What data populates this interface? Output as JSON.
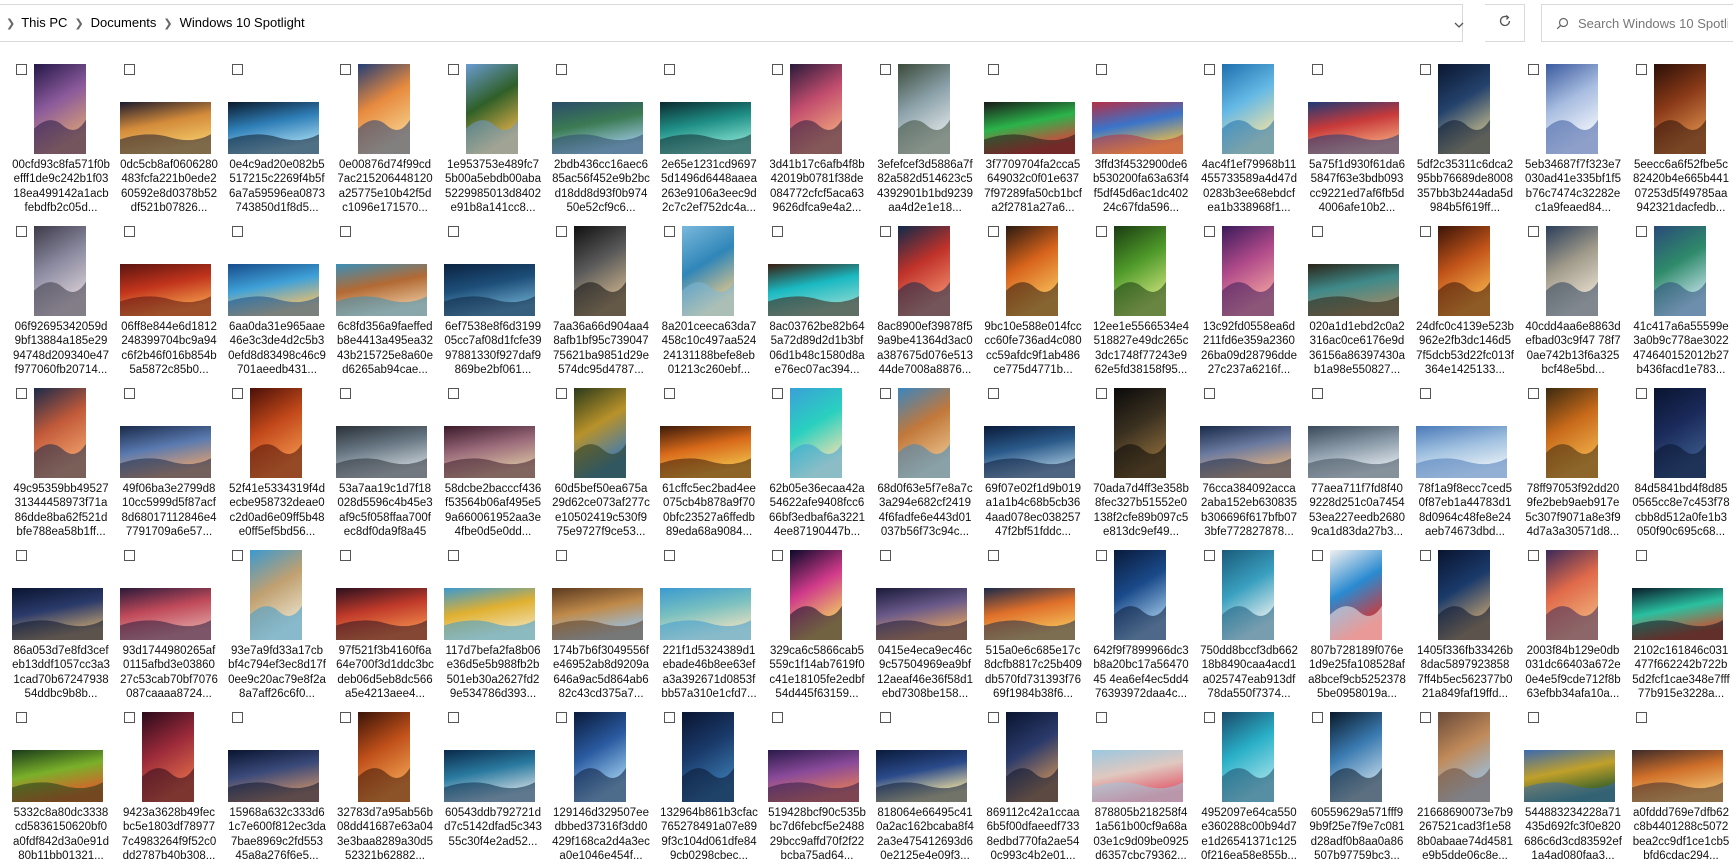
{
  "address_bar": {
    "breadcrumbs": [
      "This PC",
      "Documents",
      "Windows 10 Spotlight"
    ]
  },
  "search": {
    "placeholder": "Search Windows 10 Spotlight"
  },
  "icons": {
    "refresh": "refresh-icon",
    "search": "search-icon",
    "dropdown": "chevron-down-icon",
    "separator": "chevron-right-icon"
  },
  "files": [
    {
      "name": "00cfd93c8fa571f0befff1de9c242b1f0318ea499142a1acbfebdfb2c05d...",
      "orientation": "portrait",
      "colors": [
        "#241848",
        "#8b5a9b",
        "#d8a077"
      ]
    },
    {
      "name": "0dc5cb8af0606280483fcfa221b0ede260592e8d0378b52df521b07826...",
      "orientation": "landscape",
      "colors": [
        "#1d1b2e",
        "#d38b3a",
        "#f4c96a"
      ]
    },
    {
      "name": "0e4c9ad20e082b5517215c2269f4b5f6a7a59596ea0873743850d1f8d5...",
      "orientation": "landscape",
      "colors": [
        "#0b1a2b",
        "#2f7fb8",
        "#a3d8ef"
      ]
    },
    {
      "name": "0e00876d74f99cd7ac215206448120a25775e10b42f5dc1096e171570...",
      "orientation": "portrait",
      "colors": [
        "#223e75",
        "#e78a3e",
        "#f6d08c"
      ]
    },
    {
      "name": "1e953753e489fc75b00a5ebdb00aba5229985013d8402e91b8a141cc8...",
      "orientation": "portrait",
      "colors": [
        "#6b9bd1",
        "#2f5f28",
        "#e2b04a"
      ]
    },
    {
      "name": "2bdb436cc16aec685ac56f452e9b2bcd18dd8d93f0b97450e52cf9c6...",
      "orientation": "landscape",
      "colors": [
        "#2b4b6b",
        "#3b7b53",
        "#9ac4de"
      ]
    },
    {
      "name": "2e65e1231cd96975d1496d6448aaea263e9106a3eec9d2c7c2ef752dc4a...",
      "orientation": "landscape",
      "colors": [
        "#0c2a30",
        "#1f8f86",
        "#85e0d0"
      ]
    },
    {
      "name": "3d41b17c6afb4f8b42019b0781f38de084772cfcf5aca639626dfca9e4a2...",
      "orientation": "portrait",
      "colors": [
        "#2a1a3a",
        "#c24d6e",
        "#f1a57d"
      ]
    },
    {
      "name": "3efefcef3d5886a7f82a582d514623c54392901b1bd9239aa4d2e1e18...",
      "orientation": "portrait",
      "colors": [
        "#3b4a3a",
        "#8aa0a8",
        "#dfe6e8"
      ]
    },
    {
      "name": "3f7709704fa2cca5649032c0f01e6377f97289fa50cb1bcfa2f2781a27a6...",
      "orientation": "landscape",
      "colors": [
        "#1a1a1a",
        "#2bb34a",
        "#e23c3c"
      ]
    },
    {
      "name": "3ffd3f4532900de6b530200fa63a63f4f5df45d6ac1dc40224c67fda596...",
      "orientation": "landscape",
      "colors": [
        "#b52f45",
        "#3a74c9",
        "#f0c043"
      ]
    },
    {
      "name": "4ac4f1ef79968b11455733589a4d47d0283b3ee68ebdcfea1b338968f1...",
      "orientation": "portrait",
      "colors": [
        "#1e6fae",
        "#65b9e5",
        "#f0e1a5"
      ]
    },
    {
      "name": "5a75f1d930f61da65847f63e3bdb093cc9221ed7af6fb5d4006afe10b2...",
      "orientation": "landscape",
      "colors": [
        "#1d3a76",
        "#c83a3a",
        "#f2a27a"
      ]
    },
    {
      "name": "5df2c35311c6dca295bb76689de8008357bb3b244ada5d984b5f619ff...",
      "orientation": "portrait",
      "colors": [
        "#0a1630",
        "#24426c",
        "#c2b98a"
      ]
    },
    {
      "name": "5eb34687f7f323e7030ad41e335bf1f5b76c7474c32282ec1a9feaed84...",
      "orientation": "portrait",
      "colors": [
        "#3b5aa0",
        "#a8bde0",
        "#f3f6fb"
      ]
    },
    {
      "name": "5eecc6a6f52fbe5c82420b4e665b44107253d5f49785aa942321dacfedb...",
      "orientation": "portrait",
      "colors": [
        "#2a0f08",
        "#8a3a18",
        "#d88a4a"
      ]
    },
    {
      "name": "06f92695342059d9bf13884a185e2994748d209340e47f977060fb20714...",
      "orientation": "portrait",
      "colors": [
        "#3d3a48",
        "#8b8aa0",
        "#d9cfd6"
      ]
    },
    {
      "name": "06ff8e844e6d1812248399704bc9a94c6f2b46f016b854b5a5872c85b0...",
      "orientation": "landscape",
      "colors": [
        "#5a1410",
        "#c2341c",
        "#f09a4a"
      ]
    },
    {
      "name": "6aa0da31e965aae46e3c3de4d2c5b30efd8d83498c46c9701aeedb431...",
      "orientation": "landscape",
      "colors": [
        "#174c8a",
        "#3fa1d8",
        "#f2c06a"
      ]
    },
    {
      "name": "6c8fd356a9faeffedb8e4413a495ea3243b215725e8a60ed6265ab94cae...",
      "orientation": "landscape",
      "colors": [
        "#3a8fb8",
        "#b26a34",
        "#e8c49a"
      ]
    },
    {
      "name": "6ef7538e8f6d319905cc7af08d1fcfe3997881330f927daf9869be2bf061...",
      "orientation": "landscape",
      "colors": [
        "#0b2240",
        "#1d4f7a",
        "#6aa6c8"
      ]
    },
    {
      "name": "7aa36a66d904aa48afb1bf95c73904775621ba9851d29e574dc95d4787...",
      "orientation": "portrait",
      "colors": [
        "#101010",
        "#5a5a5a",
        "#c9b08a"
      ]
    },
    {
      "name": "8a201ceeca63da7458c10c497aa52424131188befe8eb01213c260ebf...",
      "orientation": "portrait",
      "colors": [
        "#7ab8dc",
        "#2f86b8",
        "#e6c88a"
      ]
    },
    {
      "name": "8ac03762be82b645a72d89d2d1b3bf06d1b48c1580d8ae76ec07ac394...",
      "orientation": "landscape",
      "colors": [
        "#3a1c0e",
        "#1ab9c2",
        "#8ad8d0"
      ]
    },
    {
      "name": "8ac8900ef39878f59a9be41364d3ac0a387675d076e51344de7008a8876...",
      "orientation": "portrait",
      "colors": [
        "#0f2a4a",
        "#c0322a",
        "#f08a6a"
      ]
    },
    {
      "name": "9bc10e588e014fcccc60fe736ad4c080cc59afdc9f1ab486ce775d4771b...",
      "orientation": "portrait",
      "colors": [
        "#2a1a10",
        "#d8641c",
        "#f6c05a"
      ]
    },
    {
      "name": "12ee1e5566534e4518827e49dc265c3dc1748f77243e962e5fd38158f95...",
      "orientation": "portrait",
      "colors": [
        "#1a3b12",
        "#4f9a2a",
        "#c8e07a"
      ]
    },
    {
      "name": "13c92fd0558ea6d211fd6e359a236026ba09d28796dde27c237a6216f...",
      "orientation": "portrait",
      "colors": [
        "#3a1a5a",
        "#b04a8a",
        "#f0a0a0"
      ]
    },
    {
      "name": "020a1d1ebd2c0a2316ac0ce6176e9d36156a86397430ab1a98e550827...",
      "orientation": "landscape",
      "colors": [
        "#2a2418",
        "#3f8a8a",
        "#9a8a6a"
      ]
    },
    {
      "name": "24dfc0c4139e523b962e2fb3dc146d57f5dcb53d22fc013f364e1425133...",
      "orientation": "portrait",
      "colors": [
        "#3a1408",
        "#c2541a",
        "#f4b04a"
      ]
    },
    {
      "name": "40cdd4aa6e8863defbad03c9f47 78f70ae742b13f6a325bcf48e5bd...",
      "orientation": "portrait",
      "colors": [
        "#2a3e5a",
        "#a09a8a",
        "#e8e0d0"
      ]
    },
    {
      "name": "41c417a6a55599e3a0b9c778ae3022474640152012b27b436facd1e783...",
      "orientation": "portrait",
      "colors": [
        "#2a4a7a",
        "#2f8a6a",
        "#bfe0e8"
      ]
    },
    {
      "name": "49c95359bb4952731344458973f71a86dde8ba62f521dbfe788ea58b1ff...",
      "orientation": "portrait",
      "colors": [
        "#1a2a4a",
        "#c25a3a",
        "#f0a06a"
      ]
    },
    {
      "name": "49f06ba3e2799d810cc5999d5f87acf8d68017112846e47791709a6e57...",
      "orientation": "landscape",
      "colors": [
        "#1a2a4a",
        "#5a7ab0",
        "#e0a070"
      ]
    },
    {
      "name": "52f41e5334319f4decbe958732deae0c2d0ad6e09ff5b48e0ff5ef5bd56...",
      "orientation": "portrait",
      "colors": [
        "#4a1008",
        "#c2481a",
        "#f0904a"
      ]
    },
    {
      "name": "53a7aa19c1d7f18028d5596c4b45e3af9c5f058ffaa700fec8df0da9f8a453...",
      "orientation": "landscape",
      "colors": [
        "#2a3038",
        "#6a7a86",
        "#c8d0d6"
      ]
    },
    {
      "name": "58dcbe2bacccf436f53564b06af495e59a660061952aa3e4fbe0d5e0dd...",
      "orientation": "landscape",
      "colors": [
        "#3a1a2a",
        "#9a6a7a",
        "#d8c0a0"
      ]
    },
    {
      "name": "60d5bef50ea675a29d62ce073af277ce10502419c530f975e9727f9ce53...",
      "orientation": "portrait",
      "colors": [
        "#2a3a1a",
        "#b8922a",
        "#3a7ab8"
      ]
    },
    {
      "name": "61cffc5ec2bad4ee075cb4b878a9f700bfc23527a6ffedb89eda68a9084...",
      "orientation": "landscape",
      "colors": [
        "#3a1a0a",
        "#d86a1a",
        "#f0c04a"
      ]
    },
    {
      "name": "62b05e36ecaa42a54622afe9408fcc666bf3edbaf6a32214ee87190447b...",
      "orientation": "portrait",
      "colors": [
        "#3aa0d8",
        "#2ad0c0",
        "#f0e0b0"
      ]
    },
    {
      "name": "68d0f63e5f7e8a7c3a294e682cf24194f6fadfe6e443d01037b56f73c94c...",
      "orientation": "portrait",
      "colors": [
        "#3a86c0",
        "#c2783a",
        "#e8c08a"
      ]
    },
    {
      "name": "69f07e02f1d9b019a1a1b4c68b5cb364aad078ec03825747f2bf51fddc...",
      "orientation": "landscape",
      "colors": [
        "#0a1a3a",
        "#2a5a8a",
        "#a0c0d8"
      ]
    },
    {
      "name": "70ada7d4ff3e358b8fec327b51552e0138f2cfe89b097c5e813dc9ef49...",
      "orientation": "portrait",
      "colors": [
        "#0a0a0a",
        "#3a3020",
        "#8a6a3a"
      ]
    },
    {
      "name": "76cca384092acca2aba152eb630835b306696f617bfb073bfe772827878...",
      "orientation": "landscape",
      "colors": [
        "#1a2a4a",
        "#6a7aa0",
        "#e0b080"
      ]
    },
    {
      "name": "77aea711f7fd8f409228d251c0a745453ea227eedb26809ca1d83da27b3...",
      "orientation": "landscape",
      "colors": [
        "#3a4a5a",
        "#8a9aa8",
        "#e0e6ec"
      ]
    },
    {
      "name": "78f1a9f8ecc7ced50f87eb1a44783d18d0964c48fe8e24aeb74673dbd...",
      "orientation": "landscape",
      "colors": [
        "#4a7ab8",
        "#a0c0e0",
        "#e8f0f6"
      ]
    },
    {
      "name": "78ff97053f92dd209fe2beb9aeb917e5c307f9071a8e3f94d7a3a30571d8...",
      "orientation": "portrait",
      "colors": [
        "#3a2a10",
        "#c86a1a",
        "#f0b04a"
      ]
    },
    {
      "name": "84d5841bd4f8d850565cc8e7c453f78cbb8d512a0fe1b3050f90c695c68...",
      "orientation": "portrait",
      "colors": [
        "#0a1430",
        "#1a2a5a",
        "#3a5a8a"
      ]
    },
    {
      "name": "86a053d7e8fd3cefeb13ddf1057cc3a31cad70b6724793854ddbc9b8b...",
      "orientation": "landscape",
      "colors": [
        "#0a1430",
        "#2a3a6a",
        "#c0a070"
      ]
    },
    {
      "name": "93d1744980265af0115afbd3e0386027c53cab70bf7076087caaaa8724...",
      "orientation": "landscape",
      "colors": [
        "#2a1a3a",
        "#c04a5a",
        "#e0a0a0"
      ]
    },
    {
      "name": "93e7a9fd33a17cbbf4c794ef3ec8d17f0ee9c20ac79e8f2a8a7aff26c6f0...",
      "orientation": "portrait",
      "colors": [
        "#3a9ad0",
        "#c0a070",
        "#e8e0c8"
      ]
    },
    {
      "name": "97f521f3b4160f6a64e700f3d1ddc3bcdeb06d5eb8dc566a5e4213aee4...",
      "orientation": "landscape",
      "colors": [
        "#2a1020",
        "#c03a2a",
        "#f08a4a"
      ]
    },
    {
      "name": "117d7befa2fa8b06e36d5e5b988fb2b501eb30a2627fd29e534786d393...",
      "orientation": "landscape",
      "colors": [
        "#3a9ad0",
        "#e0b030",
        "#f0e0b0"
      ]
    },
    {
      "name": "174b7b6f3049556fe46952ab8d9209a646a9ac5d864ab682c43cd375a7...",
      "orientation": "landscape",
      "colors": [
        "#5a3a20",
        "#c08a4a",
        "#9ac0e0"
      ]
    },
    {
      "name": "221f1d5324389d1ebade46b8ee63efa3a392671d0853fbb57a310e1cfd7...",
      "orientation": "landscape",
      "colors": [
        "#3a9ad0",
        "#7ac0c0",
        "#e8e0c0"
      ]
    },
    {
      "name": "329ca6c5866cab5559c1f14ab7619f0c41e18105fe2edbf54d445f63159...",
      "orientation": "portrait",
      "colors": [
        "#0a0a2a",
        "#d03a8a",
        "#f0d060"
      ]
    },
    {
      "name": "0415e4eca9ec46c9c57504969ea9bf12aeaf46e36f58d1ebd7308be158...",
      "orientation": "landscape",
      "colors": [
        "#1a1a3a",
        "#6a5a8a",
        "#e0a060"
      ]
    },
    {
      "name": "515a0e6c685e17c8dcfb8817c25b409db570fd731393f7669f1984b38f6...",
      "orientation": "landscape",
      "colors": [
        "#1a2a4a",
        "#e0702a",
        "#f4c05a"
      ]
    },
    {
      "name": "642f9f7899966dc3b8a20bc17a5647045 4ea6ef4ec5dd476393972daa4c...",
      "orientation": "portrait",
      "colors": [
        "#0a1a3a",
        "#1a4a8a",
        "#a0c8e8"
      ]
    },
    {
      "name": "750dd8bccf3db66218b8490caa4acd1a025747eab913df78da550f7374...",
      "orientation": "portrait",
      "colors": [
        "#1a5a7a",
        "#3aa0c0",
        "#e8f0f0"
      ]
    },
    {
      "name": "807b728189f076e1d9e25fa108528afa8bcef9cb52523785be0958019a...",
      "orientation": "portrait",
      "colors": [
        "#f0f0f0",
        "#2a8ad0",
        "#e0302a"
      ]
    },
    {
      "name": "1405f336fb33426b8dac5897923858 7ff4b5ec562377b021a849faf19ffd...",
      "orientation": "portrait",
      "colors": [
        "#0a1430",
        "#1a3a6a",
        "#c0a070"
      ]
    },
    {
      "name": "2003f84b129e0db031dc66403a672e0e4e5f9cde712f8b63efbb34afa10a...",
      "orientation": "portrait",
      "colors": [
        "#3a2a5a",
        "#e06a4a",
        "#f0b07a"
      ]
    },
    {
      "name": "2102c161846c031477f662242b722b5d2fcf1cae348e7fff77b915e3228a...",
      "orientation": "landscape",
      "colors": [
        "#0a1a2a",
        "#2ac0a0",
        "#d04a2a"
      ]
    },
    {
      "name": "5332c8a80dc3338cd5836150620bf0a0fdf842d3a0e91d80b11bb01321...",
      "orientation": "landscape",
      "colors": [
        "#1a3a1a",
        "#7ab02a",
        "#e05a2a"
      ]
    },
    {
      "name": "9423a3628b49fecbc5e1803df789777c4983264f9f52c0dd2787b40b308...",
      "orientation": "portrait",
      "colors": [
        "#2a0a1a",
        "#9a2a3a",
        "#e06a4a"
      ]
    },
    {
      "name": "15968a632c333d61c7e600f812ec3da7bae8969c2fd55345a8a276f6e5...",
      "orientation": "landscape",
      "colors": [
        "#0a1430",
        "#3a4a7a",
        "#c08a6a"
      ]
    },
    {
      "name": "32783d7a95ab56b08dd41687e63a043e3baa8289a30d552321b62882...",
      "orientation": "portrait",
      "colors": [
        "#3a1408",
        "#c0501a",
        "#f0a050"
      ]
    },
    {
      "name": "60543ddb792721dd7c5142dfad5c34355c30f4e2ad52...",
      "orientation": "landscape",
      "colors": [
        "#0a2a4a",
        "#2a7aa0",
        "#c8d8e0"
      ]
    },
    {
      "name": "129146d329507eedbbed37316f3dd0429f168ca2d4a3eca0e1046e454f...",
      "orientation": "portrait",
      "colors": [
        "#0a1a3a",
        "#2a5aa0",
        "#a0d0f0"
      ]
    },
    {
      "name": "132964b861b3cfac765278491a07e899f3c104d061dfe849cb0298cbec...",
      "orientation": "portrait",
      "colors": [
        "#0a1430",
        "#1a3a6a",
        "#3a7ab0"
      ]
    },
    {
      "name": "519428bcf90c535bbc7d6febcf5e248829bcc9affd70f2f22bcba75ad64...",
      "orientation": "landscape",
      "colors": [
        "#2a1a4a",
        "#8a4a9a",
        "#e07a5a"
      ]
    },
    {
      "name": "818064e66495c410a2ac162bcaba8f42a3e475412693d60e2125e4e09f3...",
      "orientation": "landscape",
      "colors": [
        "#0a1a3a",
        "#2a4a8a",
        "#f0e0a0"
      ]
    },
    {
      "name": "869112c42a1ccaa6b5f00dfaeedf7338edbd770fa2ae540c993c4b2e01...",
      "orientation": "portrait",
      "colors": [
        "#0a1430",
        "#2a3a6a",
        "#c08a5a"
      ]
    },
    {
      "name": "878805b218258f41a561b00cf9a68a03e1c9d09be0925d6357cbc79362...",
      "orientation": "landscape",
      "colors": [
        "#9ac8e0",
        "#e0c8c0",
        "#e05a6a"
      ]
    },
    {
      "name": "4952097e64ca550e360288c00b94d7e1d26541371c1250f216ea58e855b...",
      "orientation": "portrait",
      "colors": [
        "#1a4a6a",
        "#2ab0c8",
        "#a0e0e8"
      ]
    },
    {
      "name": "60559629a571fff99b9f25e7f9e7c081d28adf0b8aa0a86507b97759bc3...",
      "orientation": "portrait",
      "colors": [
        "#0a1a2a",
        "#3a7ab0",
        "#c0d8e8"
      ]
    },
    {
      "name": "21668690073e7b9267521cad3f1e588b0abaae74d4581e9b5dde06c8e...",
      "orientation": "portrait",
      "colors": [
        "#6a4a3a",
        "#c08a5a",
        "#9ac0e0"
      ]
    },
    {
      "name": "544883234228a71435d692fc3f0e820686c6d3cd83592ef1a4ad080faa3...",
      "orientation": "landscape",
      "colors": [
        "#3a6ab0",
        "#c0a02a",
        "#2a5a2a"
      ]
    },
    {
      "name": "a0fddd769e7dfb62c8b4401288c5072bea2cc9df1ce1cb5bfd6cdac294...",
      "orientation": "landscape",
      "colors": [
        "#3a2a2a",
        "#d0702a",
        "#f0c070"
      ]
    }
  ]
}
